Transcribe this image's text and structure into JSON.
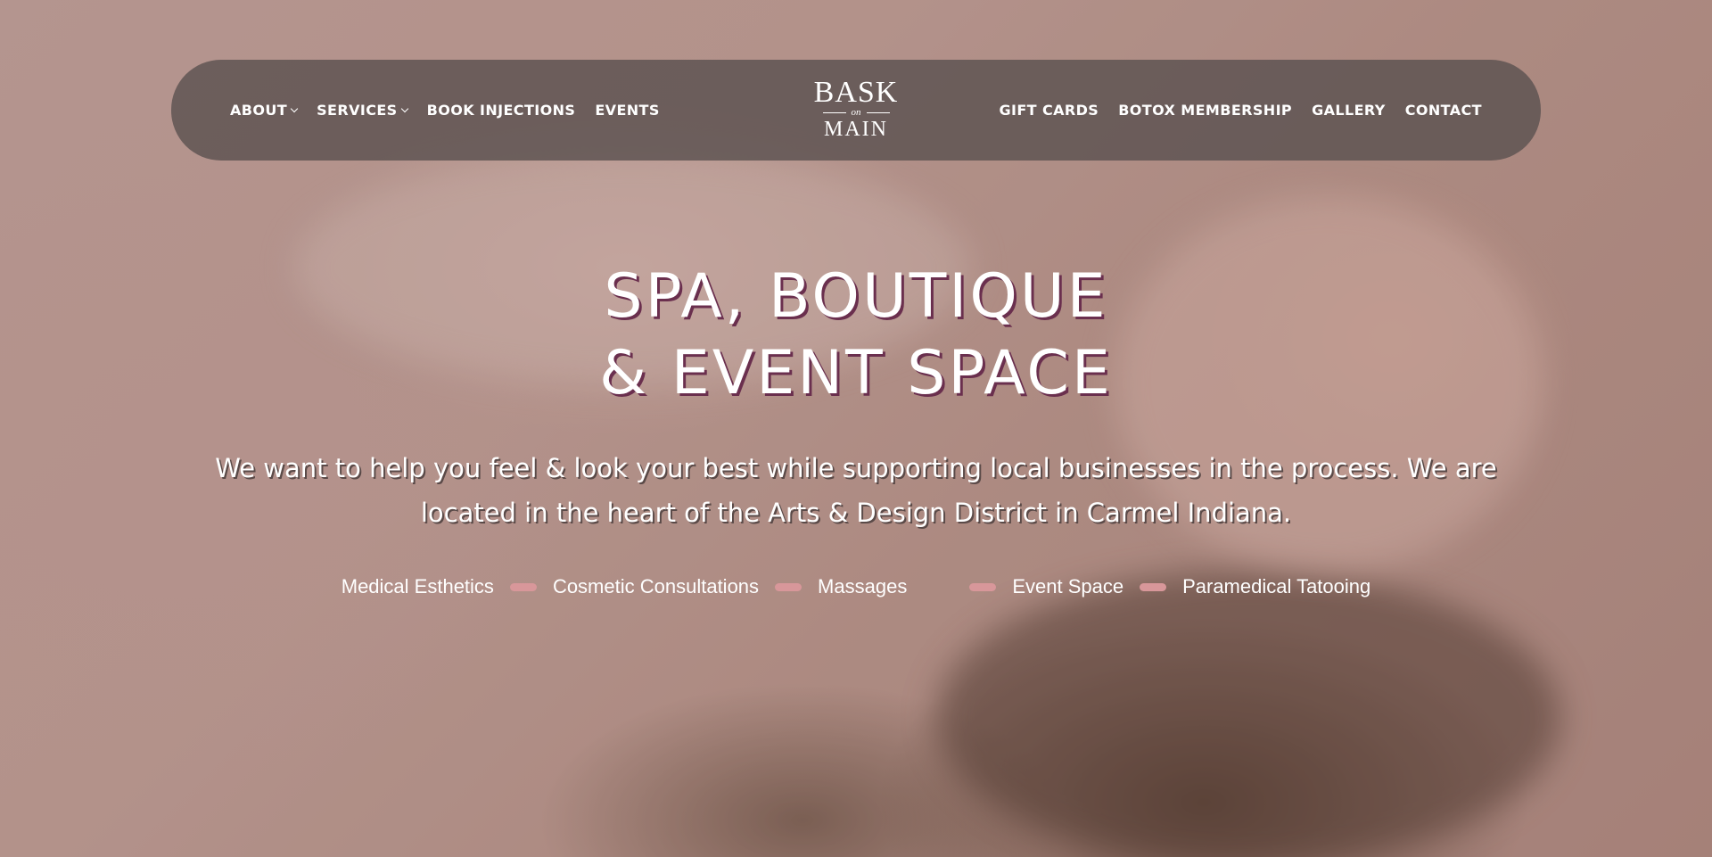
{
  "nav": {
    "left": [
      {
        "label": "ABOUT",
        "dropdown": true
      },
      {
        "label": "SERVICES",
        "dropdown": true
      },
      {
        "label": "BOOK INJECTIONS",
        "dropdown": false
      },
      {
        "label": "EVENTS",
        "dropdown": false
      }
    ],
    "right": [
      {
        "label": "GIFT CARDS"
      },
      {
        "label": "BOTOX MEMBERSHIP"
      },
      {
        "label": "GALLERY"
      },
      {
        "label": "CONTACT"
      }
    ],
    "logo": {
      "top": "BASK",
      "middle": "on",
      "bottom": "MAIN"
    }
  },
  "hero": {
    "headline_line1": "SPA, BOUTIQUE",
    "headline_line2": "& EVENT SPACE",
    "subtext_line1": "We want to help you feel & look your best while supporting local businesses in the process. We are",
    "subtext_line2": "located in the heart of the Arts & Design District in Carmel Indiana.",
    "services": [
      "Medical Esthetics",
      "Cosmetic Consultations",
      "Massages",
      "Event Space",
      "Paramedical Tatooing"
    ]
  },
  "colors": {
    "nav_bg": "#5c5250",
    "headline_shadow": "#6a2f4e",
    "separator": "#d8979a",
    "text": "#ffffff"
  },
  "icons": {
    "dropdown": "chevron-down-icon"
  }
}
